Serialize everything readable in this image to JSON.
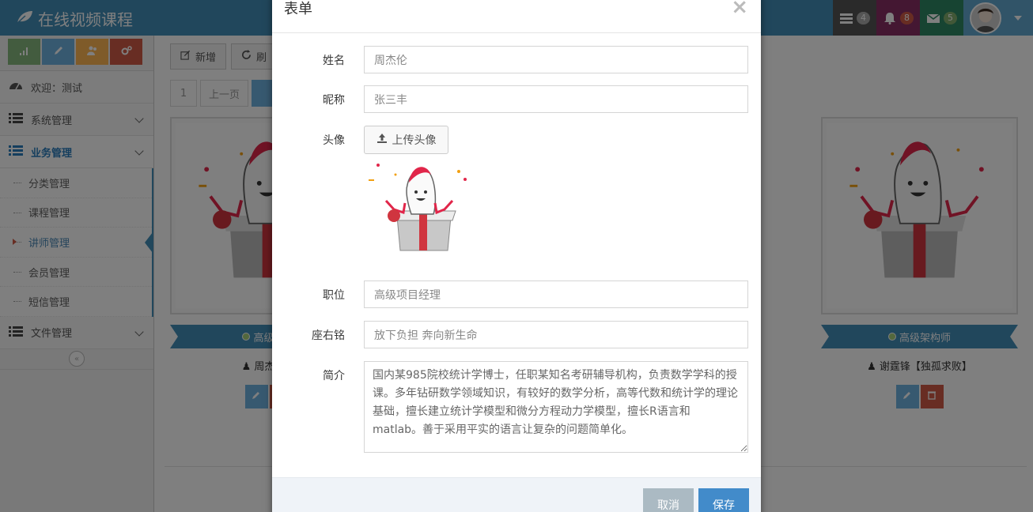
{
  "app": {
    "title": "在线视频课程"
  },
  "navbar": {
    "tasks_count": "4",
    "notifications_count": "8",
    "messages_count": "5"
  },
  "sidebar": {
    "welcome": "欢迎：测试",
    "menus": [
      {
        "label": "系统管理"
      },
      {
        "label": "业务管理"
      },
      {
        "label": "文件管理"
      }
    ],
    "sub_items": [
      {
        "label": "分类管理"
      },
      {
        "label": "课程管理"
      },
      {
        "label": "讲师管理"
      },
      {
        "label": "会员管理"
      },
      {
        "label": "短信管理"
      }
    ]
  },
  "toolbar": {
    "add_label": "新增",
    "refresh_label": "刷"
  },
  "pager": {
    "first": "1",
    "prev": "上一页"
  },
  "cards": [
    {
      "title": "高级项目",
      "name": "周杰伦【"
    },
    {
      "title": "高级架构师",
      "name": "谢霆锋【独孤求败】"
    }
  ],
  "modal": {
    "title": "表单",
    "close": "×",
    "fields": {
      "name_label": "姓名",
      "name_value": "周杰伦",
      "nickname_label": "昵称",
      "nickname_value": "张三丰",
      "avatar_label": "头像",
      "upload_label": "上传头像",
      "position_label": "职位",
      "position_value": "高级项目经理",
      "motto_label": "座右铭",
      "motto_value": "放下负担 奔向新生命",
      "intro_label": "简介",
      "intro_value": "国内某985院校统计学博士，任职某知名考研辅导机构，负责数学学科的授课。多年钻研数学领域知识，有较好的数学分析，高等代数和统计学的理论基础，擅长建立统计学模型和微分方程动力学模型，擅长R语言和matlab。善于采用平实的语言让复杂的问题简单化。"
    },
    "cancel_label": "取消",
    "save_label": "保存"
  },
  "colors": {
    "navbar": "#438eb9",
    "save": "#428bca",
    "cancel": "#abbac3",
    "delete": "#d15b47"
  }
}
